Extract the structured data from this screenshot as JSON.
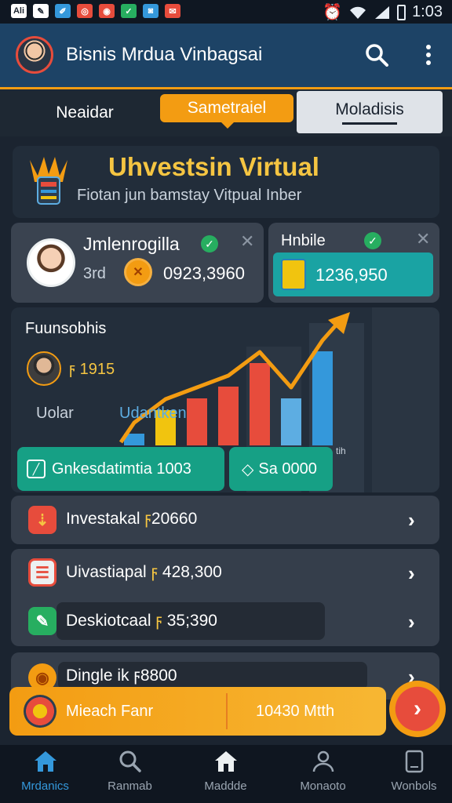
{
  "status_bar": {
    "left_icons": [
      {
        "icon": "signal-app-icon",
        "text": "Ali",
        "color": "#ffffff",
        "text_color": "#1b2430"
      },
      {
        "icon": "note-app-icon",
        "text": "✎",
        "color": "#ffffff",
        "text_color": "#1b2430"
      },
      {
        "icon": "pen-app-icon",
        "text": "✐",
        "color": "#3498db",
        "text_color": "#ffffff"
      },
      {
        "icon": "target-app-icon",
        "text": "◎",
        "color": "#e74c3c",
        "text_color": "#ffffff"
      },
      {
        "icon": "stop-app-icon",
        "text": "◉",
        "color": "#e74c3c",
        "text_color": "#ffffff"
      },
      {
        "icon": "check-app-icon",
        "text": "✓",
        "color": "#27ae60",
        "text_color": "#ffffff"
      },
      {
        "icon": "camera-app-icon",
        "text": "◙",
        "color": "#3498db",
        "text_color": "#ffffff"
      },
      {
        "icon": "mail-app-icon",
        "text": "✉",
        "color": "#e74c3c",
        "text_color": "#ffffff"
      }
    ],
    "time": "1:03"
  },
  "app_bar": {
    "title": "Bisnis Mrdua Vinbagsai",
    "accent_color": "#f39c12"
  },
  "tabs": [
    {
      "label": "Neaidar",
      "active": false
    },
    {
      "label": "Sametraiel",
      "active": true
    },
    {
      "label": "Moladisis",
      "active": false
    }
  ],
  "banner": {
    "title": "Uhvestsin Virtual",
    "subtitle": "Fiotan jun bamstay Vitpual Inber"
  },
  "user_card": {
    "name": "Jmlenrogilla",
    "sub": "3rd",
    "amount": "0923,3960"
  },
  "mobile_card": {
    "label": "Hnbile",
    "amount": "1236,950"
  },
  "chart_data": {
    "type": "bar",
    "title": "Fuunsobhis",
    "categories": [
      "",
      "",
      "",
      "",
      "",
      "",
      ""
    ],
    "values": [
      1,
      3,
      4,
      5,
      7,
      4,
      8
    ],
    "colors": [
      "#3498db",
      "#f1c40f",
      "#e74c3c",
      "#e74c3c",
      "#e74c3c",
      "#5dade2",
      "#3498db"
    ],
    "trend": "up",
    "xlabel": "",
    "ylabel": ""
  },
  "chart_labels": {
    "person_value": "1915",
    "left_label": "Uolar",
    "right_label": "Udantken",
    "corner": "tih"
  },
  "green_buttons": [
    {
      "label": "Gnkesdatimtia 1003"
    },
    {
      "label": "Sa 0000"
    }
  ],
  "rows": [
    {
      "label": "Investakal",
      "value": "20660"
    },
    {
      "label": "Uivastiapal",
      "value": "428,300"
    },
    {
      "label": "Deskiotcaal",
      "value": "35;390"
    },
    {
      "label": "Dingle ik",
      "value": "8800"
    }
  ],
  "currency_symbol": "ϝ",
  "promo": {
    "left": "Mieach Fanr",
    "right": "10430 Mtth"
  },
  "bottom_nav": [
    {
      "label": "Mrdanics",
      "icon": "home-icon",
      "active": true
    },
    {
      "label": "Ranmab",
      "icon": "search-icon",
      "active": false
    },
    {
      "label": "Maddde",
      "icon": "house-icon",
      "active": false
    },
    {
      "label": "Monaoto",
      "icon": "profile-icon",
      "active": false
    },
    {
      "label": "Wonbols",
      "icon": "tablet-icon",
      "active": false
    }
  ]
}
